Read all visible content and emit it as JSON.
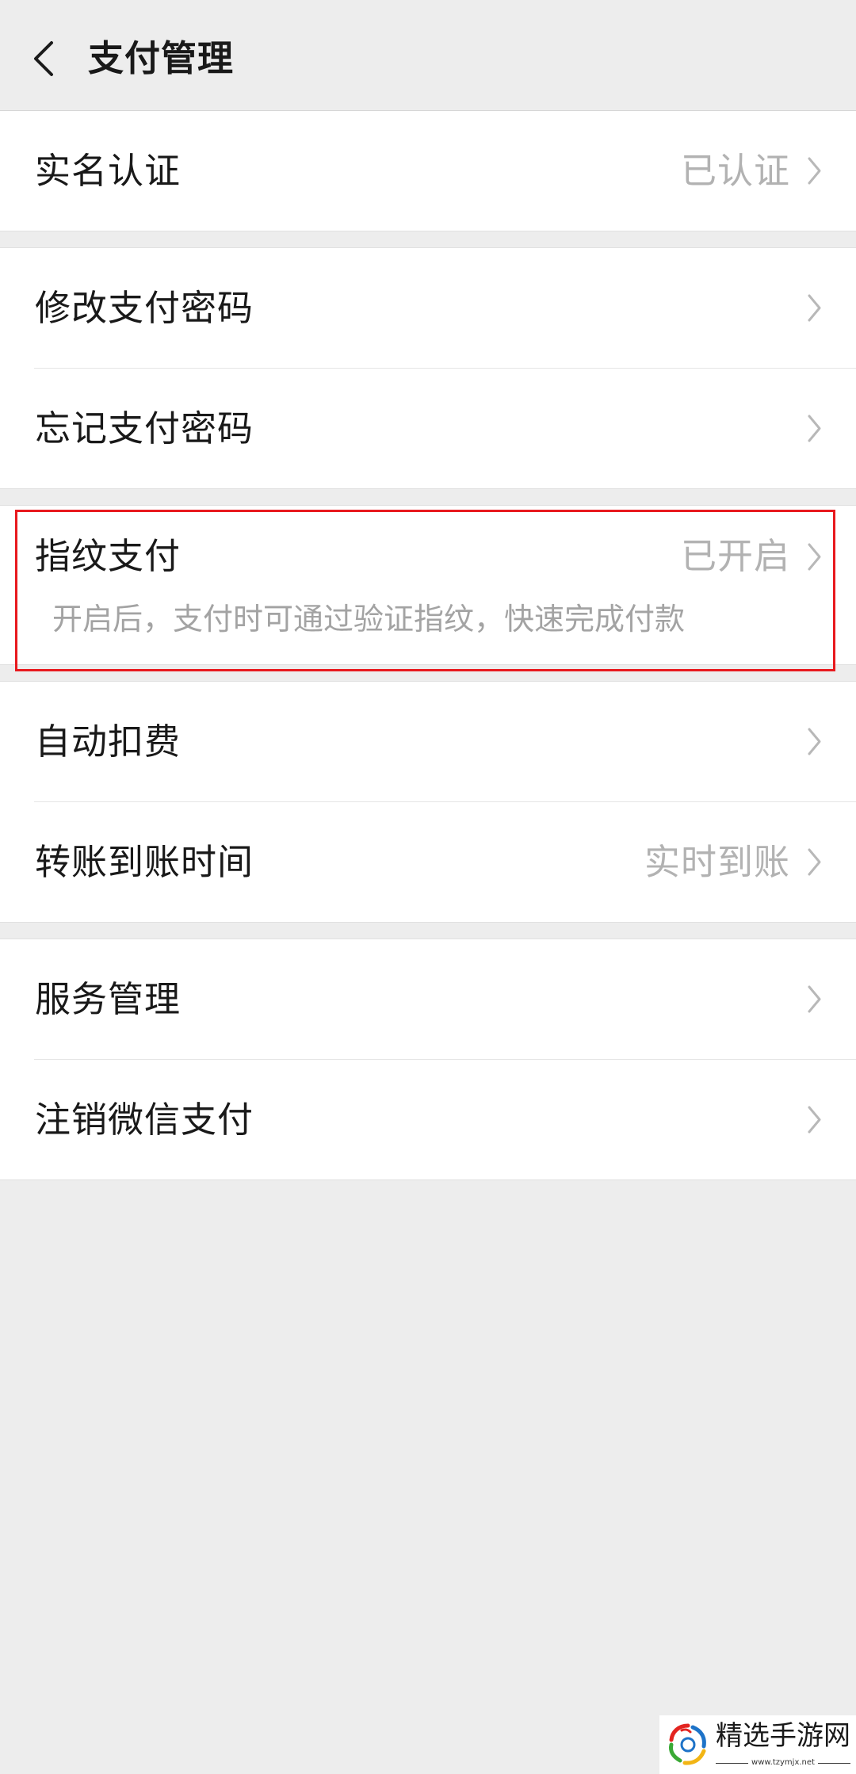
{
  "header": {
    "title": "支付管理"
  },
  "icons": {
    "back": "chevron-left-icon",
    "row_arrow": "chevron-right-icon",
    "watermark_logo": "logo-icon"
  },
  "colors": {
    "page_background": "#ededed",
    "row_background": "#ffffff",
    "secondary_text": "#b2b2b2",
    "highlight_box": "#e8191e"
  },
  "groups": [
    {
      "rows": [
        {
          "label": "实名认证",
          "value": "已认证"
        }
      ]
    },
    {
      "rows": [
        {
          "label": "修改支付密码"
        },
        {
          "label": "忘记支付密码"
        }
      ]
    },
    {
      "rows": [
        {
          "label": "指纹支付",
          "value": "已开启",
          "description": "开启后，支付时可通过验证指纹，快速完成付款"
        }
      ]
    },
    {
      "rows": [
        {
          "label": "自动扣费"
        },
        {
          "label": "转账到账时间",
          "value": "实时到账"
        }
      ]
    },
    {
      "rows": [
        {
          "label": "服务管理"
        },
        {
          "label": "注销微信支付"
        }
      ]
    }
  ],
  "watermark": {
    "brand": "精选手游网",
    "url": "www.tzymjx.net"
  }
}
